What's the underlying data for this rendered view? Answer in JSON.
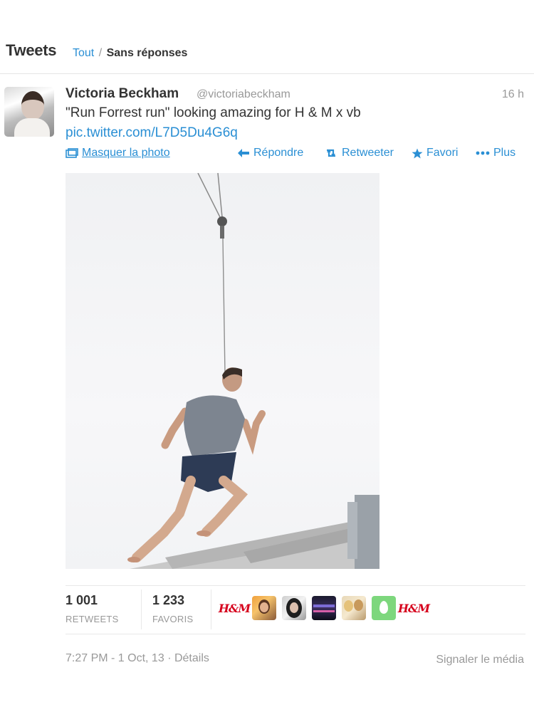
{
  "header": {
    "title": "Tweets",
    "filter_all": "Tout",
    "filter_separator": "/",
    "filter_no_replies": "Sans réponses"
  },
  "tweet": {
    "author_name": "Victoria Beckham",
    "author_handle": "@victoriabeckham",
    "time_ago": "16 h",
    "text": "\"Run Forrest run\" looking amazing for H & M x vb",
    "link": "pic.twitter.com/L7D5Du4G6q",
    "actions": {
      "hide_photo": "Masquer la photo",
      "reply": "Répondre",
      "retweet": "Retweeter",
      "favorite": "Favori",
      "more": "Plus"
    },
    "stats": {
      "retweets_count": "1 001",
      "retweets_label": "RETWEETS",
      "favorites_count": "1 233",
      "favorites_label": "FAVORIS"
    },
    "favoriters": [
      {
        "type": "brand",
        "label": "H&M"
      },
      {
        "type": "avatar",
        "icon": "avatar-woman-orange"
      },
      {
        "type": "avatar",
        "icon": "avatar-woman-dark-hair"
      },
      {
        "type": "avatar",
        "icon": "avatar-group-dark"
      },
      {
        "type": "avatar",
        "icon": "avatar-two-women"
      },
      {
        "type": "avatar",
        "icon": "default-egg-avatar"
      },
      {
        "type": "brand",
        "label": "H&M"
      }
    ],
    "footer": {
      "timestamp": "7:27 PM - 1 Oct, 13",
      "details": "Détails",
      "report_media": "Signaler le média"
    }
  },
  "colors": {
    "link": "#2a8fd4",
    "muted": "#999999",
    "text": "#333333",
    "brand_red": "#d6001c",
    "egg_green": "#7dd77d"
  }
}
